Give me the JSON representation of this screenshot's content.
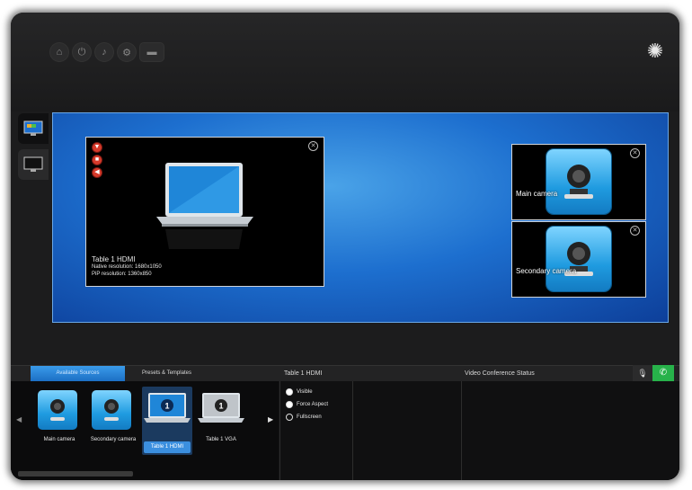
{
  "header": {
    "icons": [
      "home-icon",
      "power-icon",
      "volume-icon",
      "gear-icon",
      "keyboard-icon"
    ],
    "settings_icon": "settings-gear-icon"
  },
  "canvas": {
    "hdmi_pane": {
      "title": "Table 1 HDMI",
      "native_resolution": "Native resolution: 1680x1050",
      "pip_resolution": "PiP resolution: 1360x850"
    },
    "main_camera_label": "Main camera",
    "secondary_camera_label": "Secondary camera"
  },
  "bottom": {
    "tabs": {
      "sources": "Available Sources",
      "presets": "Presets & Templates"
    },
    "sources": [
      {
        "label": "Main camera",
        "icon": "camera-icon"
      },
      {
        "label": "Secondary camera",
        "icon": "camera-icon"
      },
      {
        "label": "Table 1 HDMI",
        "icon": "laptop-icon",
        "badge": "1"
      },
      {
        "label": "Table 1 VGA",
        "icon": "laptop-icon",
        "badge": "1"
      }
    ],
    "selected_source_title": "Table 1 HDMI",
    "options": {
      "visible": "Visible",
      "force_aspect": "Force Aspect",
      "fullscreen": "Fullscreen"
    },
    "vc_status_title": "Video Conference Status"
  },
  "colors": {
    "accent_blue": "#1d6fcf",
    "call_green": "#27b24a"
  }
}
